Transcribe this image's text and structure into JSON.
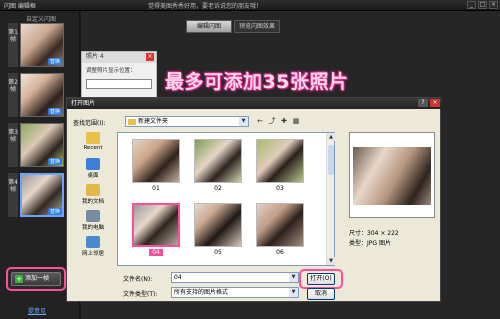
{
  "window": {
    "title": "闪图 编辑框",
    "tip": "觉得美图秀秀好用，要老诉说您的朋友哦！",
    "min": "_",
    "max": "□",
    "close": "×"
  },
  "left_panel": {
    "title": "自定义闪图",
    "frames": [
      {
        "label": "第1帧",
        "action": "替换"
      },
      {
        "label": "第2帧",
        "action": "替换"
      },
      {
        "label": "第3帧",
        "action": "替换"
      },
      {
        "label": "第4帧",
        "action": "替换"
      }
    ],
    "add_frame": "添加一帧",
    "feedback": "提意见"
  },
  "tabs": [
    "编辑闪图",
    "预览闪图效果"
  ],
  "photo_panel": {
    "header": "照片 4",
    "label": "调整照片显示位置："
  },
  "promo": "最多可添加35张照片",
  "dialog": {
    "title": "打开图片",
    "help": "?",
    "close": "×",
    "look_in_label": "查找范围(I):",
    "look_in_value": "新建文件夹",
    "places": [
      "Recent",
      "桌面",
      "我的文档",
      "我的电脑",
      "网上邻居"
    ],
    "files": [
      "01",
      "02",
      "03",
      "04",
      "05",
      "06"
    ],
    "selected_file": "04",
    "size_label": "尺寸：304 × 222",
    "type_label": "类型：JPG 图片",
    "filename_label": "文件名(N):",
    "filename_value": "04",
    "filetype_label": "文件类型(T):",
    "filetype_value": "所有支持的图片格式",
    "open_button": "打开(O)",
    "cancel_button": "取消"
  }
}
